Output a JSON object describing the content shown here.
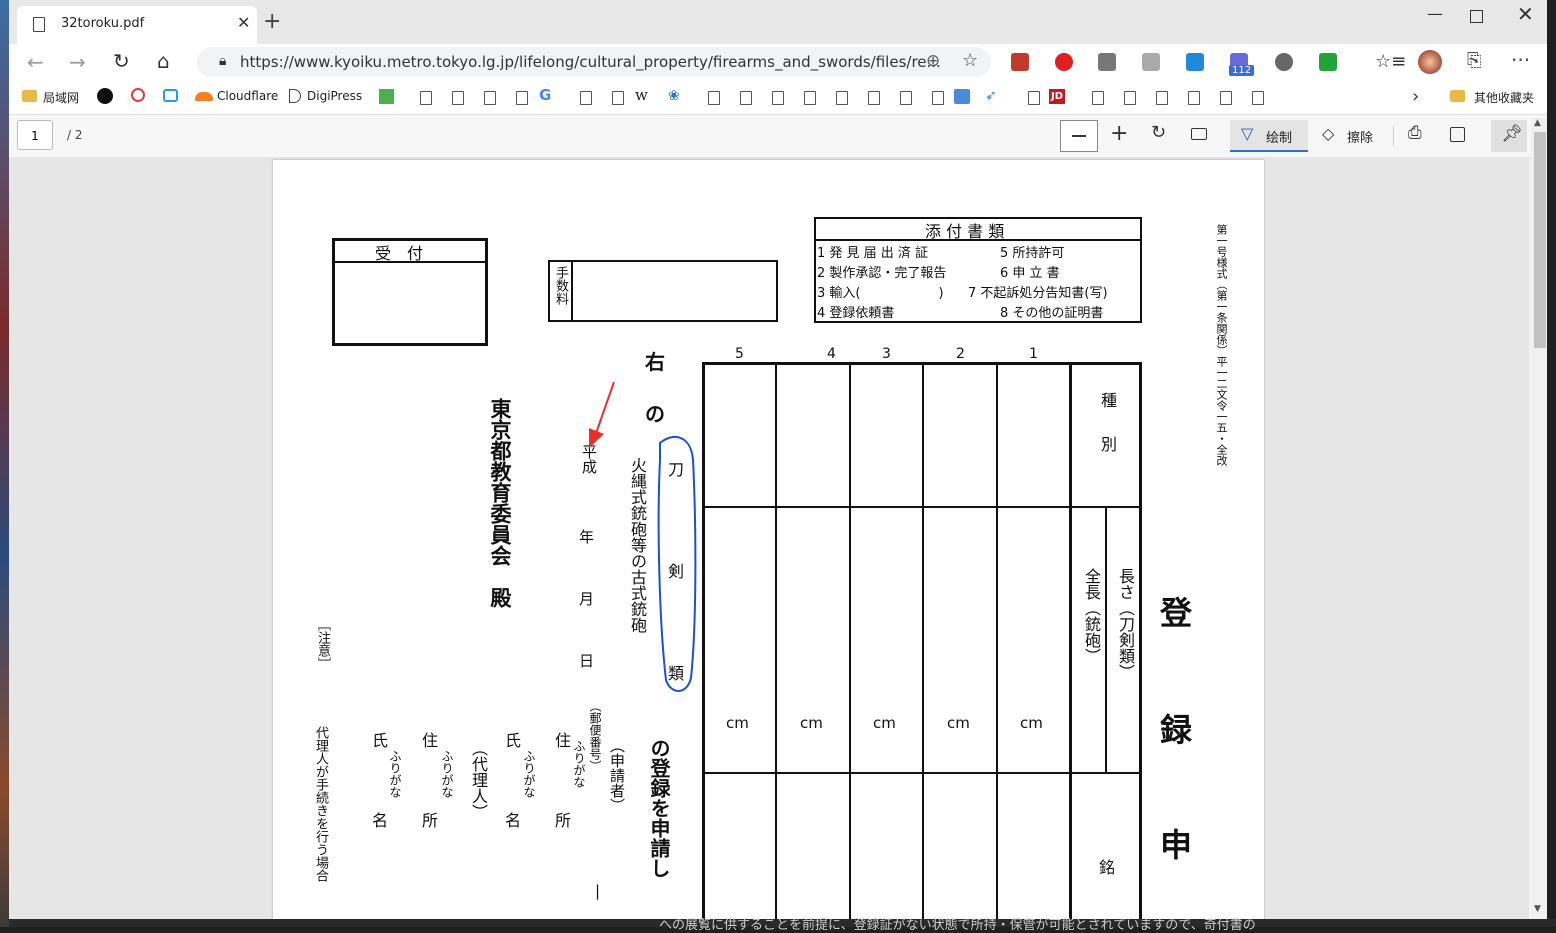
{
  "browser": {
    "tab_title": "32toroku.pdf",
    "url": "https://www.kyoiku.metro.tokyo.lg.jp/lifelong/cultural_property/firearms_and_swords/files/re...",
    "ext_badge": "112",
    "bookmarks": [
      "局域网",
      "Cloudflare",
      "DigiPress"
    ],
    "bookmark_other": "其他收藏夹"
  },
  "pdf_toolbar": {
    "page_current": "1",
    "page_total": "/ 2",
    "draw_label": "绘制",
    "erase_label": "擦除"
  },
  "form": {
    "uketsuke": "受　付",
    "tesuryo": "手数料",
    "tenpu_title": "添 付 書 類",
    "tenpu_items": [
      "1 発 見 届 出 済 証",
      "2 製作承認・完了報告",
      "3 輸入(　　　　　　)",
      "4 登録依頼書",
      "5 所持許可",
      "6 申 立 書",
      "7 不起訴処分告知書(写)",
      "8 その他の証明書"
    ],
    "form_no": "第一号様式（第一条関係）平一二文令一五・全改",
    "title_chars": [
      "登",
      "録",
      "申"
    ],
    "col_numbers": [
      "5",
      "4",
      "3",
      "2",
      "1"
    ],
    "shubetsu": "種別",
    "nagasa": "長さ（刀剣類）",
    "zencho": "全長（銃砲）",
    "unit": "cm",
    "mei": "銘",
    "migi": "右",
    "no": "の",
    "sword_lines": [
      "刀",
      "剣",
      "類"
    ],
    "hinawa": "火縄式銃砲等の古式銃砲",
    "torokushinsei": "の登録を申請し",
    "heisei": "平成",
    "nen": "年",
    "tsuki": "月",
    "hi": "日",
    "shinseisha": "（申請者）",
    "yubin": "（郵便番号）",
    "furigana": "ふりがな",
    "jusho": "住　所",
    "shimei": "氏　名",
    "dairinin": "（代理人）",
    "dash": "|",
    "kyoiku": "東京都教育委員会　殿",
    "chui": "［注意］",
    "chui_text": "代理人が手続きを行う場合",
    "bottom_text": "への展覧に供することを前提に、登録証がない状態で所持・保管が可能とされていますので、奇付書の"
  },
  "colors": {
    "accent": "#2b6ed8",
    "annotation_blue": "#1a4fd8",
    "annotation_red": "#e53030"
  }
}
